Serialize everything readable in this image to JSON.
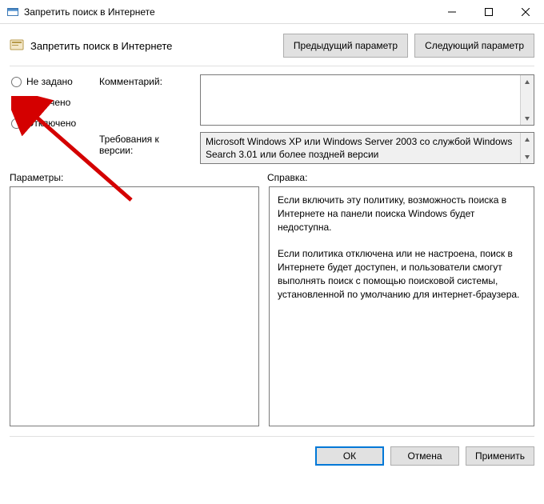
{
  "window": {
    "title": "Запретить поиск в Интернете"
  },
  "header": {
    "title": "Запретить поиск в Интернете",
    "prev_button": "Предыдущий параметр",
    "next_button": "Следующий параметр"
  },
  "config": {
    "not_configured": "Не задано",
    "enabled": "Включено",
    "disabled": "Отключено",
    "selected": "enabled"
  },
  "fields": {
    "comment_label": "Комментарий:",
    "comment_value": "",
    "requirements_label": "Требования к версии:",
    "requirements_value": "Microsoft Windows XP или Windows Server 2003 со службой Windows Search 3.01 или более поздней версии"
  },
  "sections": {
    "params_label": "Параметры:",
    "help_label": "Справка:",
    "help_text": "Если включить эту политику, возможность поиска в Интернете на панели поиска Windows будет недоступна.\n\nЕсли политика отключена или не настроена, поиск в Интернете будет доступен, и пользователи смогут выполнять поиск с помощью поисковой системы, установленной по умолчанию для интернет-браузера."
  },
  "buttons": {
    "ok": "ОК",
    "cancel": "Отмена",
    "apply": "Применить"
  }
}
